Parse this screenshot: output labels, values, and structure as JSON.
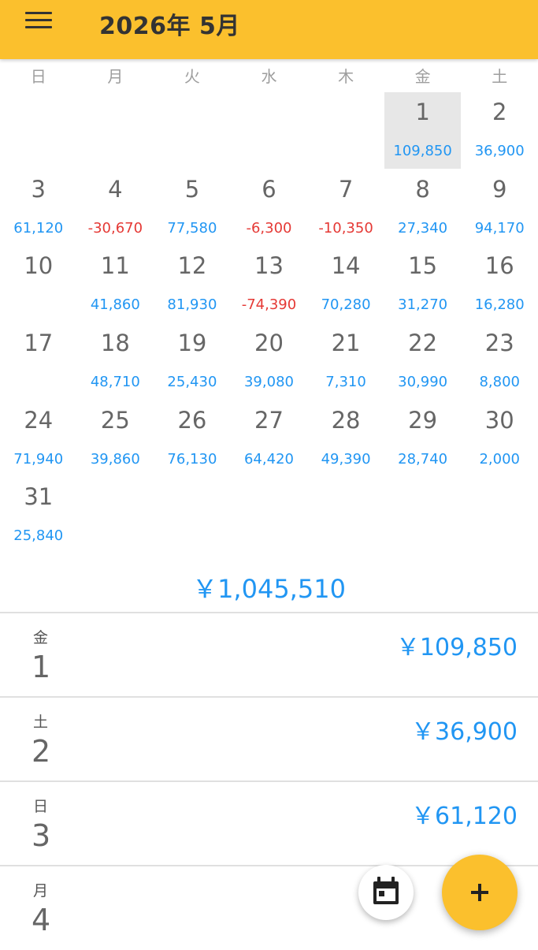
{
  "app": {
    "title": "2026年 5月",
    "menu_icon": "hamburger-menu-icon"
  },
  "colors": {
    "appbar": "#FBC02D",
    "positive": "#2196F3",
    "negative": "#E53935"
  },
  "weekdays": [
    "日",
    "月",
    "火",
    "水",
    "木",
    "金",
    "土"
  ],
  "calendar": {
    "first_weekday_index": 5,
    "selected_day": 1,
    "days": [
      {
        "day": "1",
        "amount": "109,850"
      },
      {
        "day": "2",
        "amount": "36,900"
      },
      {
        "day": "3",
        "amount": "61,120"
      },
      {
        "day": "4",
        "amount": "-30,670"
      },
      {
        "day": "5",
        "amount": "77,580"
      },
      {
        "day": "6",
        "amount": "-6,300"
      },
      {
        "day": "7",
        "amount": "-10,350"
      },
      {
        "day": "8",
        "amount": "27,340"
      },
      {
        "day": "9",
        "amount": "94,170"
      },
      {
        "day": "10",
        "amount": ""
      },
      {
        "day": "11",
        "amount": "41,860"
      },
      {
        "day": "12",
        "amount": "81,930"
      },
      {
        "day": "13",
        "amount": "-74,390"
      },
      {
        "day": "14",
        "amount": "70,280"
      },
      {
        "day": "15",
        "amount": "31,270"
      },
      {
        "day": "16",
        "amount": "16,280"
      },
      {
        "day": "17",
        "amount": ""
      },
      {
        "day": "18",
        "amount": "48,710"
      },
      {
        "day": "19",
        "amount": "25,430"
      },
      {
        "day": "20",
        "amount": "39,080"
      },
      {
        "day": "21",
        "amount": "7,310"
      },
      {
        "day": "22",
        "amount": "30,990"
      },
      {
        "day": "23",
        "amount": "8,800"
      },
      {
        "day": "24",
        "amount": "71,940"
      },
      {
        "day": "25",
        "amount": "39,860"
      },
      {
        "day": "26",
        "amount": "76,130"
      },
      {
        "day": "27",
        "amount": "64,420"
      },
      {
        "day": "28",
        "amount": "49,390"
      },
      {
        "day": "29",
        "amount": "28,740"
      },
      {
        "day": "30",
        "amount": "2,000"
      },
      {
        "day": "31",
        "amount": "25,840"
      }
    ]
  },
  "total": "￥1,045,510",
  "list": [
    {
      "weekday": "金",
      "day": "1",
      "amount": "￥109,850",
      "negative": false
    },
    {
      "weekday": "土",
      "day": "2",
      "amount": "￥36,900",
      "negative": false
    },
    {
      "weekday": "日",
      "day": "3",
      "amount": "￥61,120",
      "negative": false
    },
    {
      "weekday": "月",
      "day": "4",
      "amount": "-￥",
      "negative": true
    }
  ],
  "fab": {
    "calendar_icon": "calendar-icon",
    "add_icon": "plus-icon"
  }
}
